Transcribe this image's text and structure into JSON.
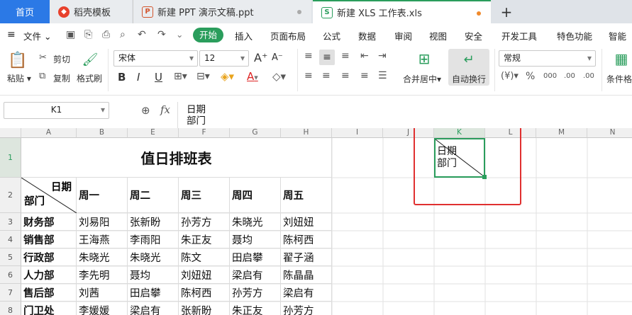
{
  "tabs": {
    "home": "首页",
    "t1": "稻壳模板",
    "t2": "新建 PPT 演示文稿.ppt",
    "t3": "新建 XLS 工作表.xls",
    "add": "+"
  },
  "menu": {
    "file": "文件",
    "start": "开始",
    "items": [
      "插入",
      "页面布局",
      "公式",
      "数据",
      "审阅",
      "视图",
      "安全",
      "开发工具",
      "特色功能",
      "智能工"
    ]
  },
  "ribbon": {
    "paste": "粘贴",
    "cut": "剪切",
    "copy": "复制",
    "format_painter": "格式刷",
    "font_name": "宋体",
    "font_size": "12",
    "merge_center": "合并居中",
    "wrap_text": "自动换行",
    "number_format": "常规",
    "cond_format": "条件格",
    "bold": "B",
    "italic": "I",
    "underline": "U",
    "grow_font": "A⁺",
    "shrink_font": "A⁻",
    "font_color_a": "A",
    "percent": "%",
    "comma": "000",
    "inc_dec": ".00",
    "currency": "¥"
  },
  "formula": {
    "name_box": "K1",
    "fx": "fx",
    "content_line1": "日期",
    "content_line2": "部门"
  },
  "columns": [
    "A",
    "B",
    "E",
    "F",
    "G",
    "H",
    "I",
    "J",
    "K",
    "L",
    "M",
    "N"
  ],
  "rows": [
    "1",
    "2",
    "3",
    "4",
    "5",
    "6",
    "7",
    "8"
  ],
  "sheet": {
    "title": "值日排班表",
    "diag_top": "日期",
    "diag_bottom": "部门",
    "days": [
      "周一",
      "周二",
      "周三",
      "周四",
      "周五"
    ],
    "data": [
      [
        "财务部",
        "刘易阳",
        "张新盼",
        "孙芳方",
        "朱晓光",
        "刘妞妞"
      ],
      [
        "销售部",
        "王海燕",
        "李雨阳",
        "朱正友",
        "聂均",
        "陈柯西"
      ],
      [
        "行政部",
        "朱晓光",
        "朱晓光",
        "陈文",
        "田启攀",
        "翟子涵"
      ],
      [
        "人力部",
        "李先明",
        "聂均",
        "刘妞妞",
        "梁启有",
        "陈晶晶"
      ],
      [
        "售后部",
        "刘茜",
        "田启攀",
        "陈柯西",
        "孙芳方",
        "梁启有"
      ],
      [
        "门卫处",
        "李媛媛",
        "梁启有",
        "张新盼",
        "朱正友",
        "孙芳方"
      ]
    ],
    "k1_line1": "日期",
    "k1_line2": "部门"
  },
  "colors": {
    "accent_green": "#2a9d5c",
    "highlight_red": "#e03030",
    "home_blue": "#2b79e6"
  }
}
